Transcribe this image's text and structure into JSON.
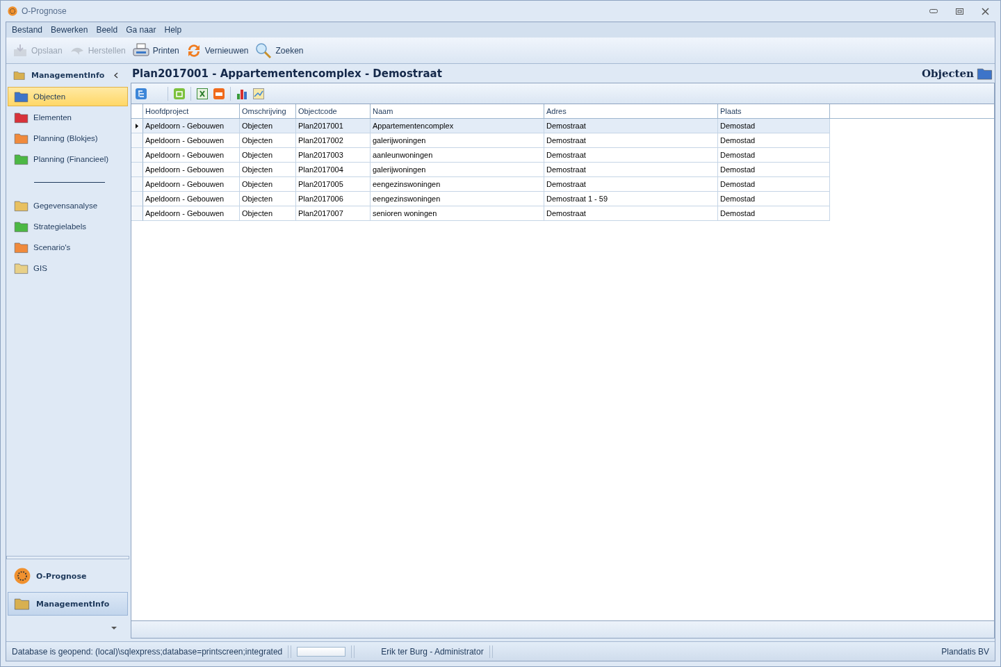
{
  "window": {
    "title": "O-Prognose"
  },
  "menu": [
    "Bestand",
    "Bewerken",
    "Beeld",
    "Ga naar",
    "Help"
  ],
  "toolbar": [
    {
      "label": "Opslaan",
      "disabled": true
    },
    {
      "label": "Herstellen",
      "disabled": true
    },
    {
      "label": "Printen",
      "disabled": false
    },
    {
      "label": "Vernieuwen",
      "disabled": false
    },
    {
      "label": "Zoeken",
      "disabled": false
    }
  ],
  "sidebar": {
    "title": "ManagementInfo",
    "groups": [
      [
        {
          "label": "Objecten",
          "selected": true
        },
        {
          "label": "Elementen",
          "selected": false
        },
        {
          "label": "Planning (Blokjes)",
          "selected": false
        },
        {
          "label": "Planning (Financieel)",
          "selected": false
        }
      ],
      [
        {
          "label": "Gegevensanalyse",
          "selected": false
        },
        {
          "label": "Strategielabels",
          "selected": false
        },
        {
          "label": "Scenario's",
          "selected": false
        },
        {
          "label": "GIS",
          "selected": false
        }
      ]
    ],
    "panes": [
      {
        "label": "O-Prognose",
        "selected": false
      },
      {
        "label": "ManagementInfo",
        "selected": true
      }
    ]
  },
  "content": {
    "title": "Plan2017001 - Appartementencomplex - Demostraat",
    "section": "Objecten"
  },
  "table": {
    "columns": [
      "Hoofdproject",
      "Omschrijving",
      "Objectcode",
      "Naam",
      "Adres",
      "Plaats"
    ],
    "rows": [
      {
        "selected": true,
        "cells": [
          "Apeldoorn - Gebouwen",
          "Objecten",
          "Plan2017001",
          "Appartementencomplex",
          "Demostraat",
          "Demostad"
        ]
      },
      {
        "selected": false,
        "cells": [
          "Apeldoorn - Gebouwen",
          "Objecten",
          "Plan2017002",
          "galerijwoningen",
          "Demostraat",
          "Demostad"
        ]
      },
      {
        "selected": false,
        "cells": [
          "Apeldoorn - Gebouwen",
          "Objecten",
          "Plan2017003",
          "aanleunwoningen",
          "Demostraat",
          "Demostad"
        ]
      },
      {
        "selected": false,
        "cells": [
          "Apeldoorn - Gebouwen",
          "Objecten",
          "Plan2017004",
          "galerijwoningen",
          "Demostraat",
          "Demostad"
        ]
      },
      {
        "selected": false,
        "cells": [
          "Apeldoorn - Gebouwen",
          "Objecten",
          "Plan2017005",
          "eengezinswoningen",
          "Demostraat",
          "Demostad"
        ]
      },
      {
        "selected": false,
        "cells": [
          "Apeldoorn - Gebouwen",
          "Objecten",
          "Plan2017006",
          "eengezinswoningen",
          "Demostraat 1 - 59",
          "Demostad"
        ]
      },
      {
        "selected": false,
        "cells": [
          "Apeldoorn - Gebouwen",
          "Objecten",
          "Plan2017007",
          "senioren woningen",
          "Demostraat",
          "Demostad"
        ]
      }
    ]
  },
  "status_bar": {
    "database": "Database is geopend: (local)\\sqlexpress;database=printscreen;integrated",
    "progress": {
      "level": 0
    },
    "user": "Erik ter Burg - Administrator",
    "company": "Plandatis BV"
  }
}
